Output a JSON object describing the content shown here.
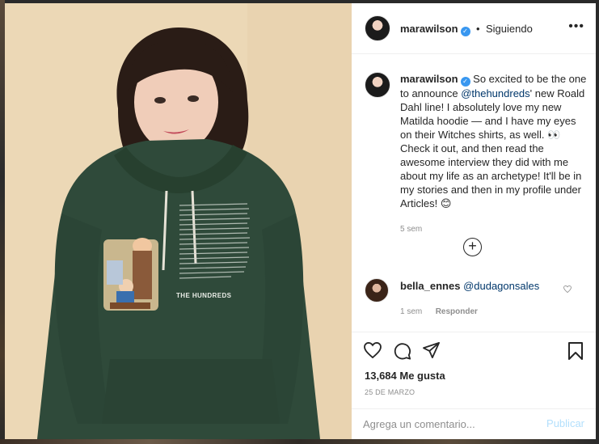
{
  "header": {
    "username": "marawilson",
    "separator": "•",
    "follow_label": "Siguiendo",
    "more_label": "•••"
  },
  "caption": {
    "username": "marawilson",
    "text_before": "So excited to be the one to announce ",
    "mention": "@thehundreds",
    "text_after": "' new Roald Dahl line! I absolutely love my new Matilda hoodie — and I have my eyes on their Witches shirts, as well. 👀 Check it out, and then read the awesome interview they did with me about my life as an archetype! It'll be in my stories and then in my profile under Articles! 😊",
    "time": "5 sem"
  },
  "load_more_label": "+",
  "comment": {
    "username": "bella_ennes",
    "mention": "@dudagonsales",
    "time": "1 sem",
    "reply_label": "Responder"
  },
  "actions": {
    "likes": "13,684 Me gusta",
    "date": "25 DE MARZO"
  },
  "comment_box": {
    "placeholder": "Agrega un comentario...",
    "publish_label": "Publicar"
  },
  "photo": {
    "hoodie_brand": "THE HUNDREDS"
  },
  "colors": {
    "link": "#00376b",
    "verified": "#3897f0",
    "publish_disabled": "#b2dffc",
    "hoodie": "#2f4a3a",
    "wall": "#ecd8b6"
  }
}
